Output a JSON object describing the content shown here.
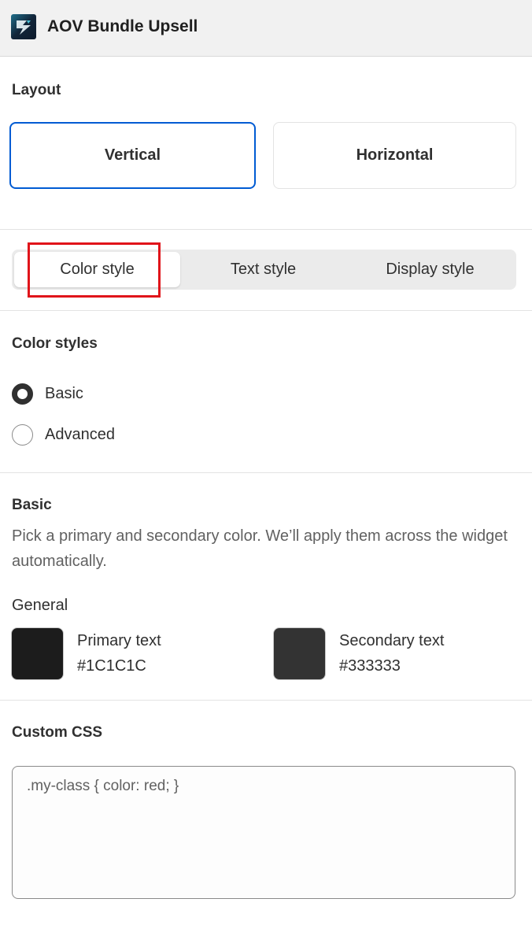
{
  "header": {
    "title": "AOV Bundle Upsell",
    "logo_icon": "aov-app-logo-icon"
  },
  "layout": {
    "title": "Layout",
    "options": [
      {
        "label": "Vertical",
        "selected": true
      },
      {
        "label": "Horizontal",
        "selected": false
      }
    ]
  },
  "tabs": {
    "items": [
      {
        "label": "Color style",
        "active": true
      },
      {
        "label": "Text style",
        "active": false
      },
      {
        "label": "Display style",
        "active": false
      }
    ]
  },
  "color_styles": {
    "title": "Color styles",
    "options": [
      {
        "label": "Basic",
        "checked": true
      },
      {
        "label": "Advanced",
        "checked": false
      }
    ]
  },
  "basic": {
    "title": "Basic",
    "description": "Pick a primary and secondary color. We’ll apply them across the widget automatically.",
    "general_label": "General",
    "colors": [
      {
        "name": "Primary text",
        "value": "#1C1C1C",
        "swatch": "#1c1c1c"
      },
      {
        "name": "Secondary text",
        "value": "#333333",
        "swatch": "#333333"
      }
    ]
  },
  "custom_css": {
    "title": "Custom CSS",
    "placeholder": ".my-class { color: red; }"
  },
  "colors": {
    "accent": "#005bd3",
    "highlight": "#e0141a"
  }
}
